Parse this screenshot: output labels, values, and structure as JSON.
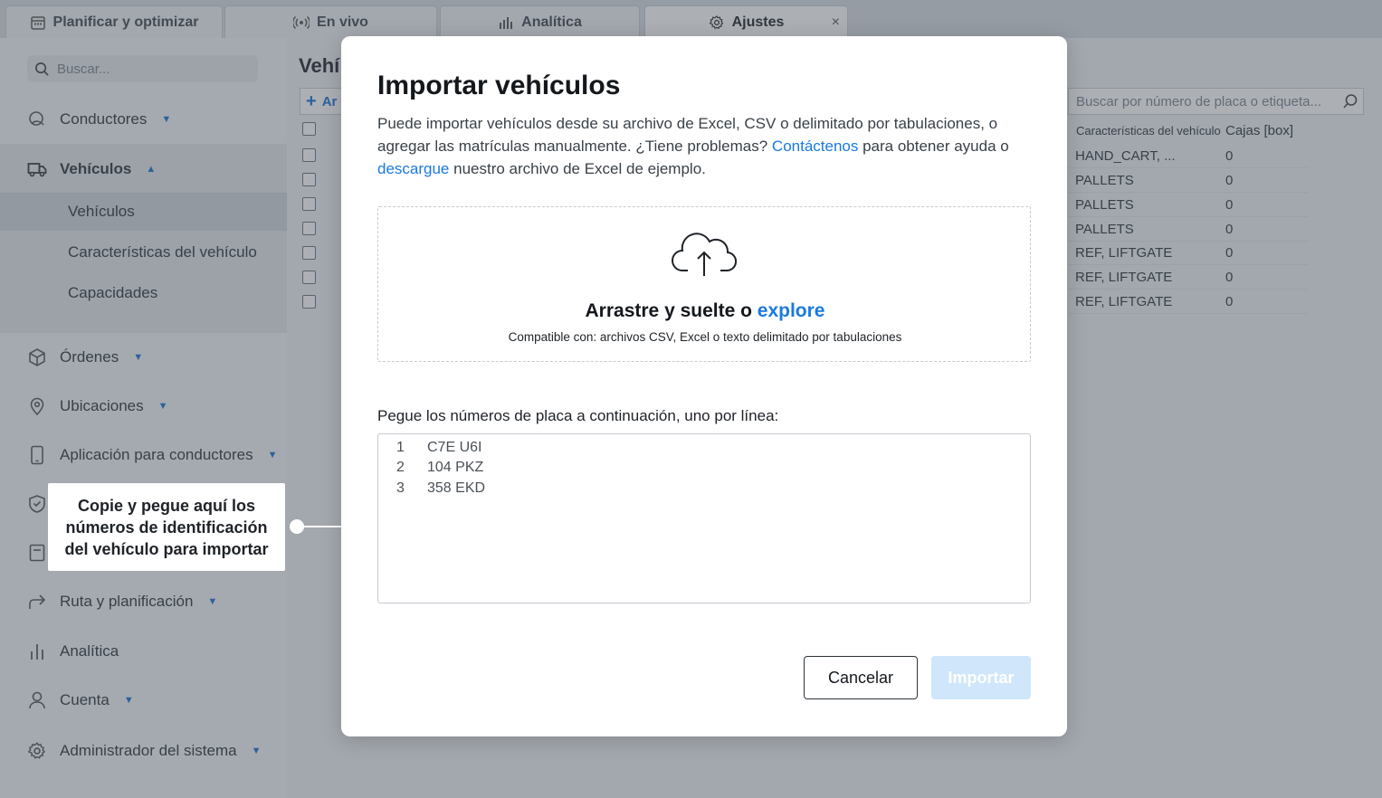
{
  "tabs": [
    {
      "label": "Planificar y optimizar",
      "icon": "calendar-icon"
    },
    {
      "label": "En vivo",
      "icon": "broadcast-icon"
    },
    {
      "label": "Analítica",
      "icon": "bar-chart-icon"
    },
    {
      "label": "Ajustes",
      "icon": "gear-icon",
      "active": true,
      "close": "×"
    }
  ],
  "sidebar": {
    "search_placeholder": "Buscar...",
    "items": [
      {
        "label": "Conductores",
        "icon": "drivers-icon",
        "caret": "▼"
      },
      {
        "label": "Vehículos",
        "icon": "truck-icon",
        "caret": "▲",
        "expanded": true
      },
      {
        "label": "Órdenes",
        "icon": "box-icon",
        "caret": "▼"
      },
      {
        "label": "Ubicaciones",
        "icon": "location-pin-icon",
        "caret": "▼"
      },
      {
        "label": "Aplicación para conductores",
        "icon": "phone-icon",
        "caret": "▼"
      },
      {
        "label": "Ruta y planificación",
        "icon": "route-arrow-icon",
        "caret": "▼"
      },
      {
        "label": "Analítica",
        "icon": "bar-chart-icon"
      },
      {
        "label": "Cuenta",
        "icon": "user-icon",
        "caret": "▼"
      },
      {
        "label": "Administrador del sistema",
        "icon": "gear-icon",
        "caret": "▼"
      }
    ],
    "subitems": [
      "Vehículos",
      "Características del vehículo",
      "Capacidades"
    ]
  },
  "main": {
    "title": "Vehí",
    "add_label": "Ar",
    "search_placeholder": "Buscar por número de placa o etiqueta...",
    "columns": [
      "Características del vehículo",
      "Cajas [box]"
    ],
    "rows": [
      [
        "HAND_CART, ...",
        "0"
      ],
      [
        "PALLETS",
        "0"
      ],
      [
        "PALLETS",
        "0"
      ],
      [
        "PALLETS",
        "0"
      ],
      [
        "REF, LIFTGATE",
        "0"
      ],
      [
        "REF, LIFTGATE",
        "0"
      ],
      [
        "REF, LIFTGATE",
        "0"
      ]
    ]
  },
  "callout": {
    "text": "Copie y pegue aquí los números de identificación del vehículo para importar"
  },
  "modal": {
    "title": "Importar vehículos",
    "desc_part1": "Puede importar vehículos desde su archivo de Excel, CSV o delimitado por tabulaciones, o agregar las matrículas manualmente. ¿Tiene problemas? ",
    "desc_link1": "Contáctenos",
    "desc_part2": " para obtener ayuda o ",
    "desc_link2": "descargue",
    "desc_part3": " nuestro archivo de Excel de ejemplo.",
    "drop_main": "Arrastre y suelte o ",
    "drop_link": "explore",
    "drop_sub": "Compatible con: archivos CSV, Excel o texto delimitado por tabulaciones",
    "paste_label": "Pegue los números de placa a continuación, uno por línea:",
    "plates": [
      {
        "n": "1",
        "plate": "C7E U6I"
      },
      {
        "n": "2",
        "plate": "104 PKZ"
      },
      {
        "n": "3",
        "plate": "358 EKD"
      }
    ],
    "cancel_label": "Cancelar",
    "import_label": "Importar"
  },
  "colors": {
    "accent": "#1a7ae0",
    "import_disabled": "#cfe6fb"
  }
}
